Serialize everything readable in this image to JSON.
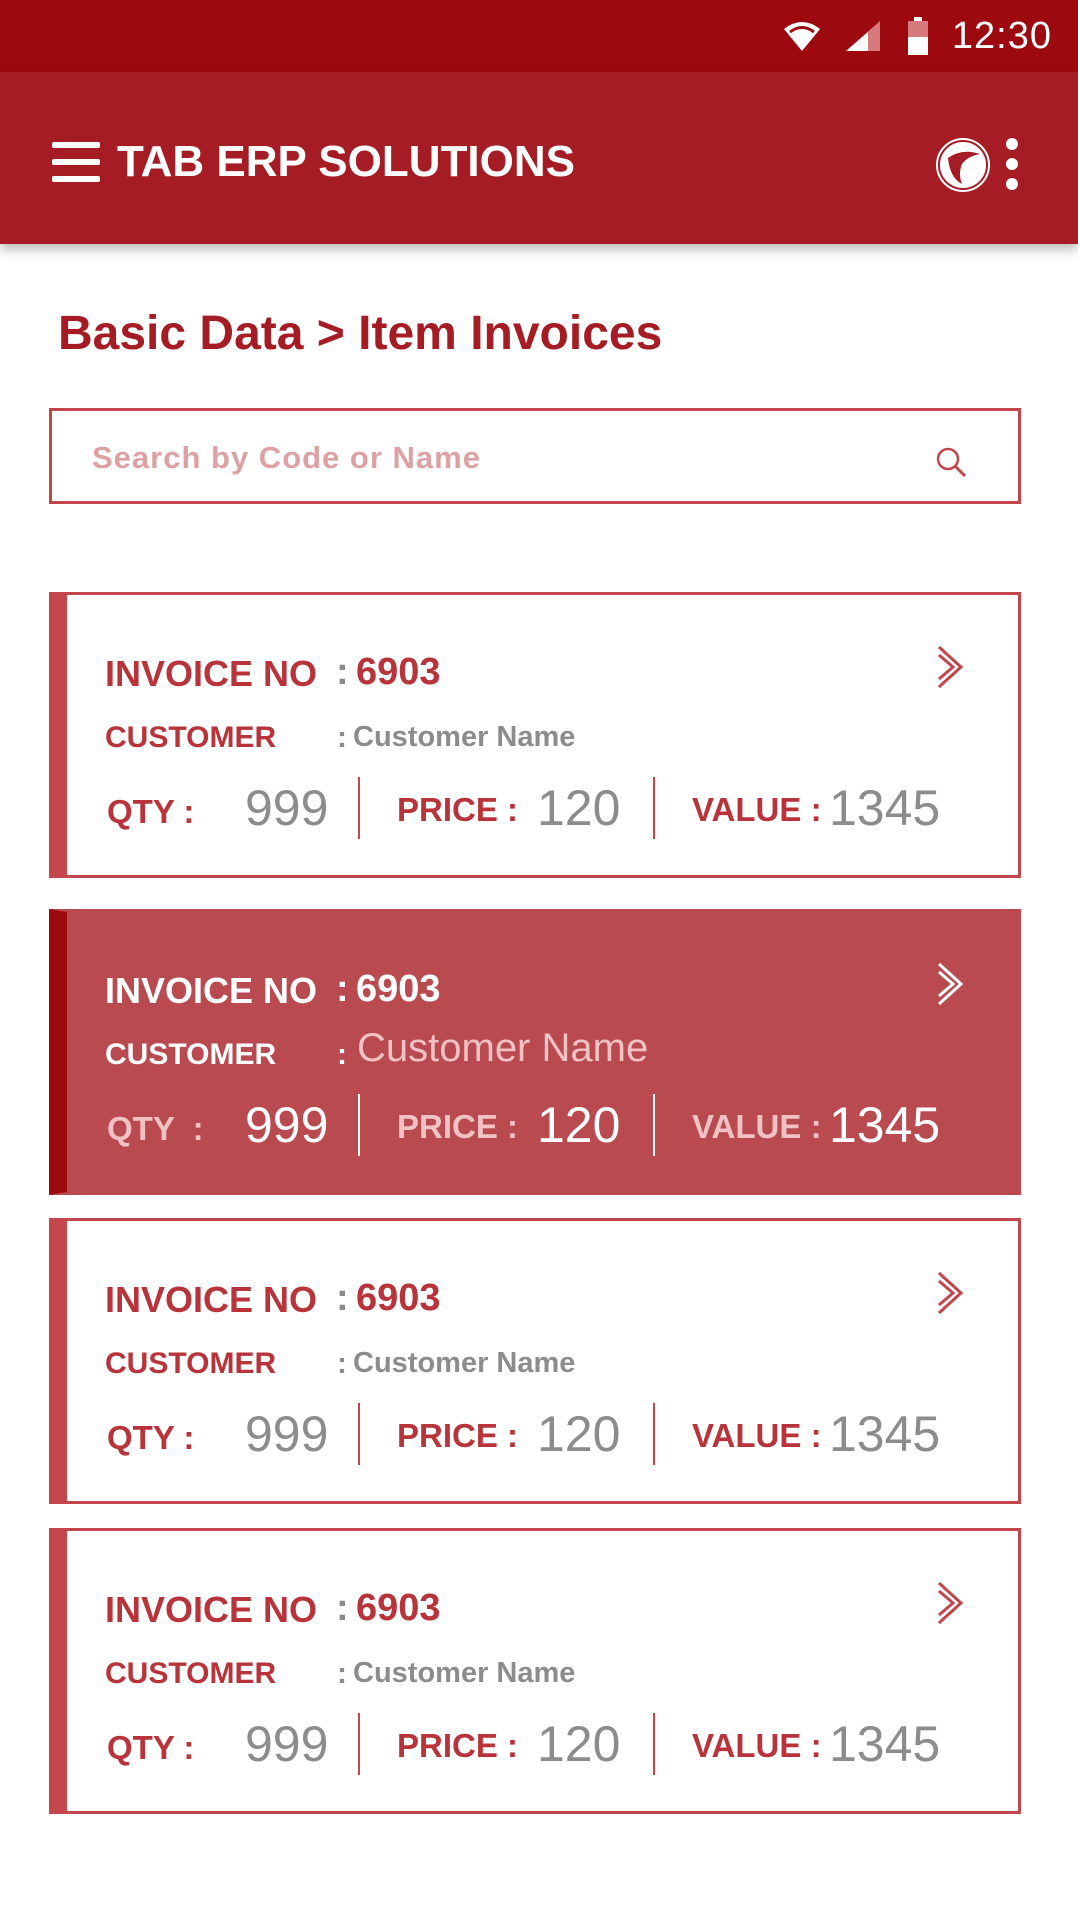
{
  "status_bar": {
    "time": "12:30",
    "icons": [
      "wifi-icon",
      "cell-signal-icon",
      "battery-icon"
    ]
  },
  "app_bar": {
    "title": "TAB ERP SOLUTIONS",
    "icons": [
      "menu-icon",
      "app-logo-icon",
      "more-vert-icon"
    ]
  },
  "breadcrumb": "Basic Data > Item Invoices",
  "search": {
    "placeholder": "Search by Code or Name",
    "value": ""
  },
  "labels": {
    "invoice_no": "INVOICE NO",
    "customer": "CUSTOMER",
    "qty": "QTY",
    "price": "PRICE",
    "value": "VALUE",
    "colon": ":"
  },
  "invoices": [
    {
      "invoice_no": "6903",
      "customer": "Customer Name",
      "qty": "999",
      "price": "120",
      "value": "1345",
      "selected": false
    },
    {
      "invoice_no": "6903",
      "customer": "Customer Name",
      "qty": "999",
      "price": "120",
      "value": "1345",
      "selected": true
    },
    {
      "invoice_no": "6903",
      "customer": "Customer Name",
      "qty": "999",
      "price": "120",
      "value": "1345",
      "selected": false
    },
    {
      "invoice_no": "6903",
      "customer": "Customer Name",
      "qty": "999",
      "price": "120",
      "value": "1345",
      "selected": false
    }
  ],
  "colors": {
    "status_bar": "#9c0a10",
    "app_bar": "#a51c24",
    "accent": "#c2464c",
    "selected_card": "#b94a50",
    "muted_text": "#8c8c8c"
  }
}
